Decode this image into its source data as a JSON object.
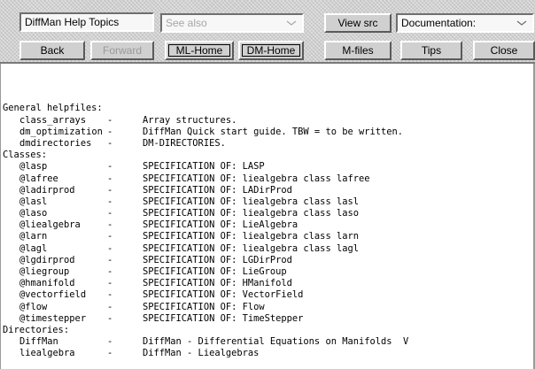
{
  "window": {
    "title": "DiffMan Help Topics"
  },
  "toolbar": {
    "topics_field": "DiffMan Help Topics",
    "see_also": {
      "value": "See also"
    },
    "view_src_label": "View src",
    "documentation": {
      "value": "Documentation:"
    },
    "back_label": "Back",
    "forward_label": "Forward",
    "ml_home_label": "ML-Home",
    "dm_home_label": "DM-Home",
    "m_files_label": "M-files",
    "tips_label": "Tips",
    "close_label": "Close"
  },
  "sections": [
    {
      "heading": "General helpfiles:",
      "items": [
        {
          "name": "class_arrays",
          "dash": "-",
          "desc": "Array structures."
        },
        {
          "name": "dm_optimization",
          "dash": "-",
          "desc": "DiffMan Quick start guide. TBW = to be written."
        },
        {
          "name": "dmdirectories",
          "dash": "-",
          "desc": "DM-DIRECTORIES."
        }
      ]
    },
    {
      "heading": "Classes:",
      "items": [
        {
          "name": "@lasp",
          "dash": "-",
          "desc": "SPECIFICATION OF: LASP"
        },
        {
          "name": "@lafree",
          "dash": "-",
          "desc": "SPECIFICATION OF: liealgebra class lafree"
        },
        {
          "name": "@ladirprod",
          "dash": "-",
          "desc": "SPECIFICATION OF: LADirProd"
        },
        {
          "name": "@lasl",
          "dash": "-",
          "desc": "SPECIFICATION OF: liealgebra class lasl"
        },
        {
          "name": "@laso",
          "dash": "-",
          "desc": "SPECIFICATION OF: liealgebra class laso"
        },
        {
          "name": "@liealgebra",
          "dash": "-",
          "desc": "SPECIFICATION OF: LieAlgebra"
        },
        {
          "name": "@larn",
          "dash": "-",
          "desc": "SPECIFICATION OF: liealgebra class larn"
        },
        {
          "name": "@lagl",
          "dash": "-",
          "desc": "SPECIFICATION OF: liealgebra class lagl"
        },
        {
          "name": "@lgdirprod",
          "dash": "-",
          "desc": "SPECIFICATION OF: LGDirProd"
        },
        {
          "name": "@liegroup",
          "dash": "-",
          "desc": "SPECIFICATION OF: LieGroup"
        },
        {
          "name": "@hmanifold",
          "dash": "-",
          "desc": "SPECIFICATION OF: HManifold"
        },
        {
          "name": "@vectorfield",
          "dash": "-",
          "desc": "SPECIFICATION OF: VectorField"
        },
        {
          "name": "@flow",
          "dash": "-",
          "desc": "SPECIFICATION OF: Flow"
        },
        {
          "name": "@timestepper",
          "dash": "-",
          "desc": "SPECIFICATION OF: TimeStepper"
        }
      ]
    },
    {
      "heading": "Directories:",
      "items": [
        {
          "name": "DiffMan",
          "dash": "-",
          "desc": "DiffMan - Differential Equations on Manifolds  V"
        },
        {
          "name": "liealgebra",
          "dash": "-",
          "desc": "DiffMan - Liealgebras"
        }
      ]
    }
  ]
}
